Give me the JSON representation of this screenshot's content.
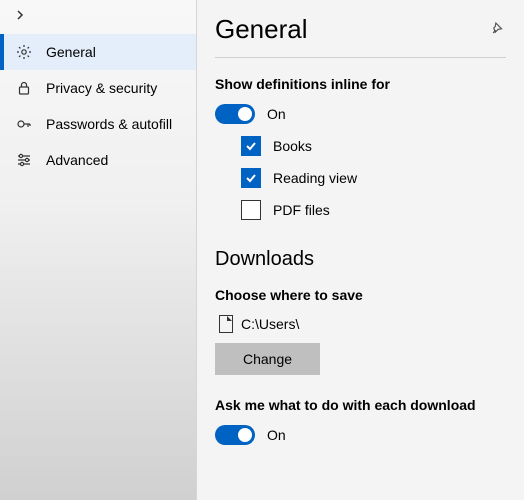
{
  "sidebar": {
    "items": [
      {
        "label": "General"
      },
      {
        "label": "Privacy & security"
      },
      {
        "label": "Passwords & autofill"
      },
      {
        "label": "Advanced"
      }
    ]
  },
  "header": {
    "title": "General"
  },
  "definitions": {
    "section_label": "Show definitions inline for",
    "toggle_label": "On",
    "options": [
      {
        "label": "Books"
      },
      {
        "label": "Reading view"
      },
      {
        "label": "PDF files"
      }
    ]
  },
  "downloads": {
    "heading": "Downloads",
    "choose_label": "Choose where to save",
    "path": "C:\\Users\\",
    "change_label": "Change",
    "ask_label": "Ask me what to do with each download",
    "ask_toggle_label": "On"
  }
}
